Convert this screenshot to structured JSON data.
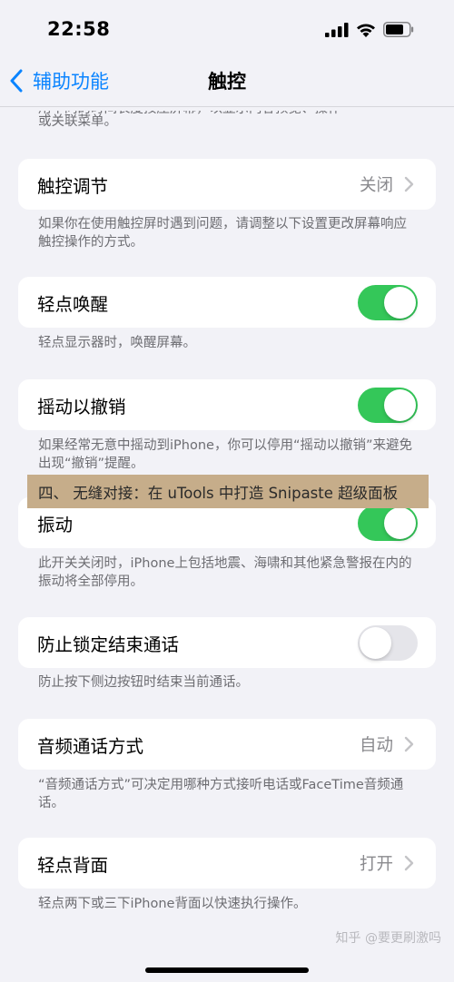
{
  "status_bar": {
    "time": "22:58",
    "icons": [
      "signal-icon",
      "wifi-icon",
      "battery-icon"
    ]
  },
  "nav": {
    "back_label": "辅助功能",
    "title": "触控"
  },
  "top_footer_partial": [
    "用不同的时间长度按压屏幕，以显示内容预览、操作",
    "或关联菜单。"
  ],
  "items": [
    {
      "label": "触控调节",
      "value": "关闭",
      "footer": "如果你在使用触控屏时遇到问题，请调整以下设置更改屏幕响应触控操作的方式。"
    },
    {
      "label": "轻点唤醒",
      "toggle": true,
      "footer": "轻点显示器时，唤醒屏幕。"
    },
    {
      "label": "摇动以撤销",
      "toggle": true,
      "footer": "如果经常无意中摇动到iPhone，你可以停用“摇动以撤销”来避免出现“撤销”提醒。"
    },
    {
      "label": "振动",
      "toggle": true,
      "footer": "此开关关闭时，iPhone上包括地震、海啸和其他紧急警报在内的振动将全部停用。"
    },
    {
      "label": "防止锁定结束通话",
      "toggle": false,
      "footer": "防止按下侧边按钮时结束当前通话。"
    },
    {
      "label": "音频通话方式",
      "value": "自动",
      "footer": "“音频通话方式”可决定用哪种方式接听电话或FaceTime音频通话。"
    },
    {
      "label": "轻点背面",
      "value": "打开",
      "footer": "轻点两下或三下iPhone背面以快速执行操作。"
    }
  ],
  "overlay_banner": "四、 无缝对接：在 uTools 中打造 Snipaste 超级面板",
  "watermark": "知乎 @要更刷激吗",
  "colors": {
    "accent": "#0a84ff",
    "toggle_on": "#34c759",
    "toggle_off": "#e5e5ea",
    "background": "#f2f2f7",
    "banner": "#c6ad8a"
  }
}
